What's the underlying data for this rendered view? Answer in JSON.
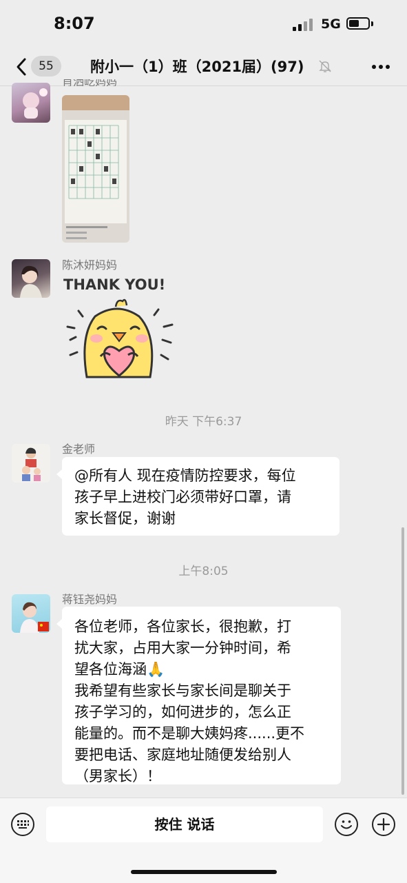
{
  "status": {
    "time": "8:07",
    "network": "5G"
  },
  "nav": {
    "unread_count": "55",
    "title": "附小一（1）班（2021届）(97)"
  },
  "messages": [
    {
      "sender": "肖洒屹妈妈",
      "type": "image"
    },
    {
      "sender": "陈沐妍妈妈",
      "type": "sticker",
      "sticker_text": "THANK YOU!"
    },
    {
      "timestamp": "昨天 下午6:37"
    },
    {
      "sender": "金老师",
      "lines": [
        "@所有人 现在疫情防控要求，每位",
        "孩子早上进校门必须带好口罩，请",
        "家长督促，谢谢"
      ]
    },
    {
      "timestamp": "上午8:05"
    },
    {
      "sender": "蒋钰尧妈妈",
      "lines": [
        "各位老师，各位家长，很抱歉，打",
        "扰大家，占用大家一分钟时间，希",
        "望各位海涵🙏",
        "我希望有些家长与家长间是聊关于",
        "孩子学习的，如何进步的，怎么正",
        "能量的。而不是聊大姨妈疼......更不",
        "要把电话、家庭地址随便发给别人",
        "（男家长）！"
      ]
    }
  ],
  "input": {
    "hold_to_talk": "按住 说话"
  },
  "icons": [
    "back-icon",
    "mute-bell-icon",
    "more-icon",
    "keyboard-icon",
    "emoji-icon",
    "plus-icon"
  ]
}
